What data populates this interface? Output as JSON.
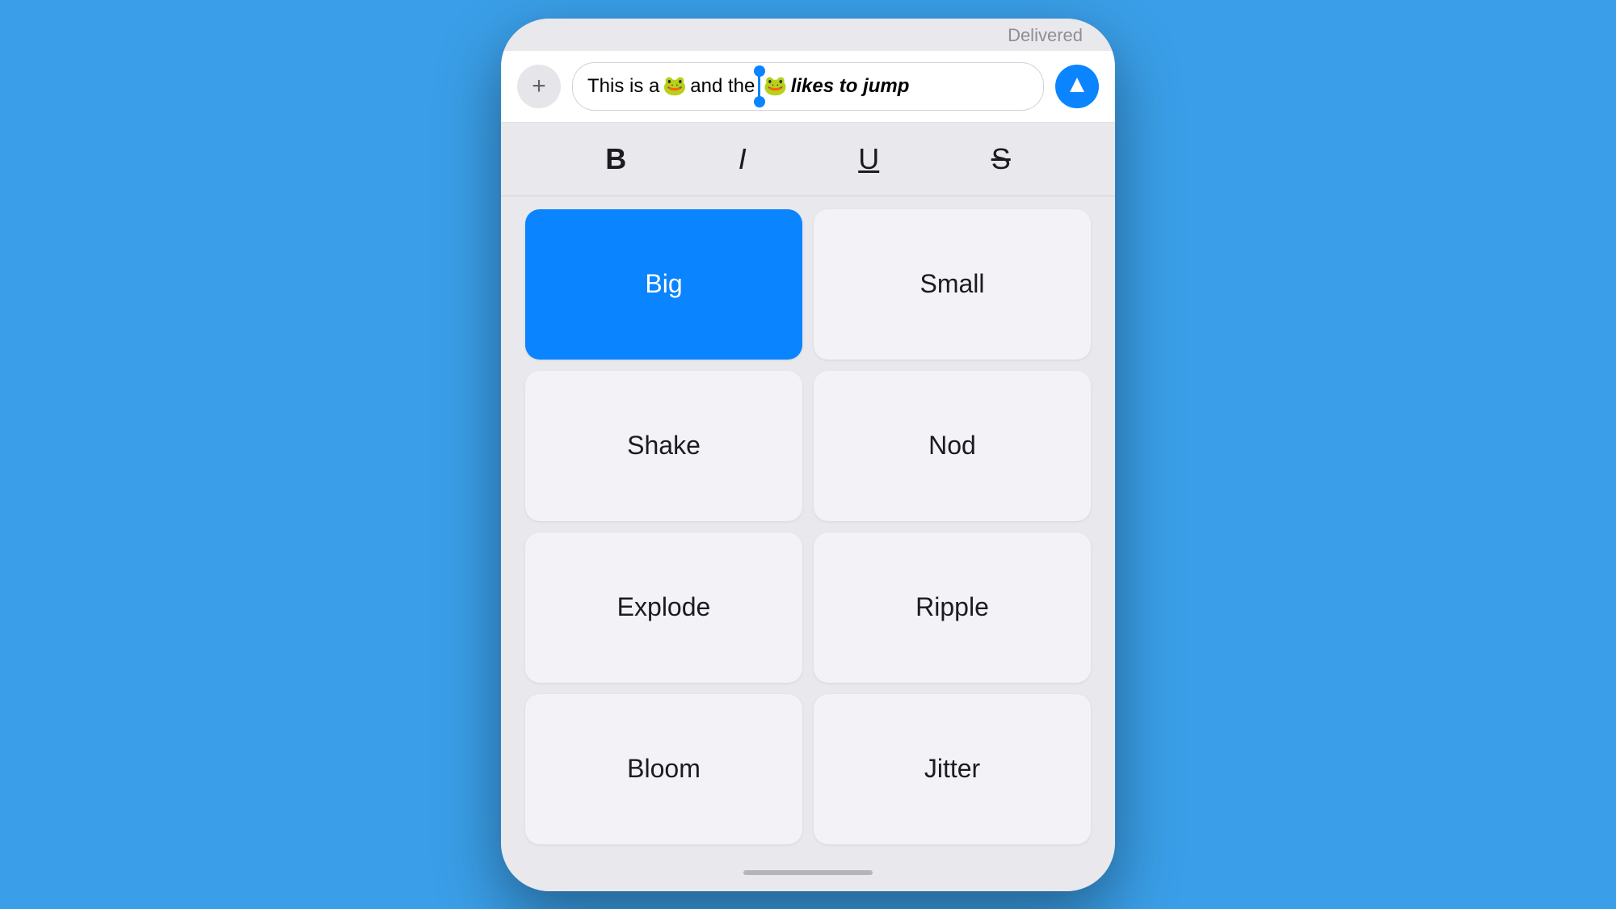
{
  "background_color": "#3a9fe8",
  "phone": {
    "delivered_label": "Delivered",
    "input": {
      "text_before_emoji1": "This is a ",
      "emoji1": "🐸",
      "text_middle": " and the ",
      "emoji2": "🐸",
      "text_after": " likes to jump",
      "add_button_label": "+",
      "send_button_label": "Send"
    },
    "formatting": {
      "bold_label": "B",
      "italic_label": "I",
      "underline_label": "U",
      "strikethrough_label": "S"
    },
    "effects": [
      {
        "label": "Big",
        "selected": true
      },
      {
        "label": "Small",
        "selected": false
      },
      {
        "label": "Shake",
        "selected": false
      },
      {
        "label": "Nod",
        "selected": false
      },
      {
        "label": "Explode",
        "selected": false
      },
      {
        "label": "Ripple",
        "selected": false
      },
      {
        "label": "Bloom",
        "selected": false
      },
      {
        "label": "Jitter",
        "selected": false
      }
    ]
  }
}
